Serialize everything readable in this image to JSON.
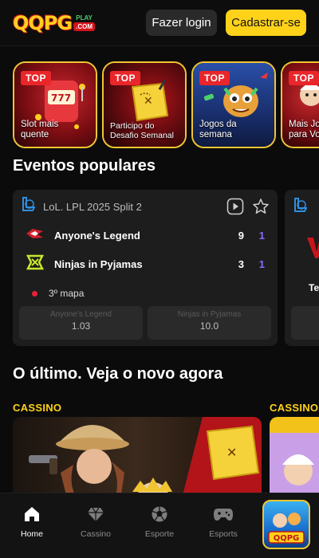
{
  "header": {
    "logo_text_qq": "QQ",
    "logo_text_pg": "PG",
    "logo_play": "PLAY",
    "logo_com": ".COM",
    "login_label": "Fazer login",
    "signup_label": "Cadastrar-se"
  },
  "promos": [
    {
      "tag": "TOP",
      "label_line1": "Slot mais",
      "label_line2": "quente"
    },
    {
      "tag": "TOP",
      "label_line1": "Participo do",
      "label_line2": "Desafio Semanal"
    },
    {
      "tag": "TOP",
      "label_line1": "Jogos da",
      "label_line2": "semana"
    },
    {
      "tag": "TOP",
      "label_line1": "Mais Jog",
      "label_line2": "para Vo"
    }
  ],
  "events": {
    "title": "Eventos populares",
    "card": {
      "league": "LoL. LPL 2025 Split 2",
      "team1": {
        "name": "Anyone's Legend",
        "score": "9",
        "maps": "1"
      },
      "team2": {
        "name": "Ninjas in Pyjamas",
        "score": "3",
        "maps": "1"
      },
      "map_status": "3º mapa",
      "odds": [
        {
          "team": "Anyone's Legend",
          "value": "1.03"
        },
        {
          "team": "Ninjas in Pyjamas",
          "value": "10.0"
        }
      ]
    },
    "card2": {
      "partial_text": "Te"
    }
  },
  "latest": {
    "title": "O último. Veja o novo agora",
    "category_left": "CASSINO",
    "category_right": "CASSINO"
  },
  "bottom_nav": [
    {
      "label": "Home",
      "icon": "home-icon",
      "active": true
    },
    {
      "label": "Cassino",
      "icon": "diamond-icon",
      "active": false
    },
    {
      "label": "Esporte",
      "icon": "soccer-ball-icon",
      "active": false
    },
    {
      "label": "Esports",
      "icon": "gamepad-icon",
      "active": false
    }
  ],
  "app_badge": {
    "text": "QQPG"
  },
  "colors": {
    "accent_yellow": "#ffd21a",
    "top_tag_red": "#e9262a",
    "maps_purple": "#8b6cff",
    "live_red": "#e8203a"
  }
}
